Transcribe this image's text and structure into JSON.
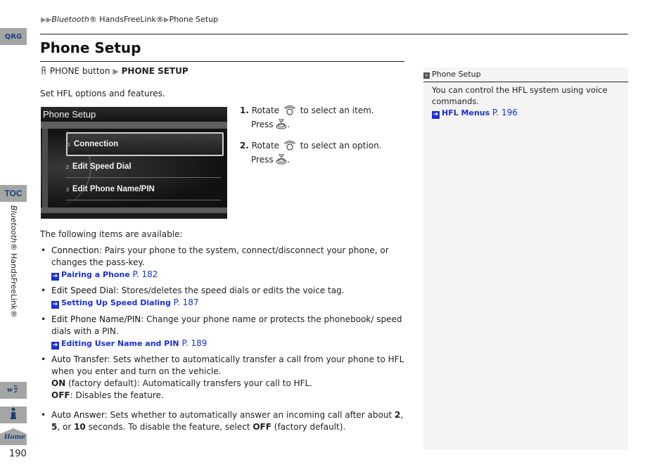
{
  "side_tabs": {
    "qrg": "QRG",
    "toc": "TOC",
    "section_label_italic": "Bluetooth",
    "section_label_rest": "® HandsFreeLink®",
    "voice_icon": "voice-command-icon",
    "index_icon": "info-index-icon",
    "home": "Home"
  },
  "breadcrumb": {
    "part1_italic": "Bluetooth",
    "part1_rest": "® HandsFreeLink®",
    "part2": "Phone Setup"
  },
  "page": {
    "title": "Phone Setup",
    "menu_path_button": "PHONE button",
    "menu_path_target": "PHONE SETUP",
    "intro": "Set HFL options and features.",
    "page_number": "190"
  },
  "screen": {
    "title": "Phone Setup",
    "items": [
      {
        "num": "1",
        "label": "Connection"
      },
      {
        "num": "2",
        "label": "Edit Speed Dial"
      },
      {
        "num": "3",
        "label": "Edit Phone Name/PIN"
      }
    ]
  },
  "steps": [
    {
      "num": "1.",
      "text_a": "Rotate",
      "text_b": "to select an item.",
      "text_c": "Press"
    },
    {
      "num": "2.",
      "text_a": "Rotate",
      "text_b": "to select an option.",
      "text_c": "Press"
    }
  ],
  "available_intro": "The following items are available:",
  "items": [
    {
      "term": "Connection",
      "desc": ": Pairs your phone to the system, connect/disconnect your phone, or changes the pass-key.",
      "xref": "Pairing a Phone",
      "xref_page": "P. 182"
    },
    {
      "term": "Edit Speed Dial",
      "desc": ": Stores/deletes the speed dials or edits the voice tag.",
      "xref": "Setting Up Speed Dialing",
      "xref_page": "P. 187"
    },
    {
      "term": "Edit Phone Name/PIN",
      "desc": ": Change your phone name or protects the phonebook/ speed dials with a PIN.",
      "xref": "Editing User Name and PIN",
      "xref_page": "P. 189"
    },
    {
      "term": "Auto Transfer",
      "desc": ": Sets whether to automatically transfer a call from your phone to HFL when you enter and turn on the vehicle.",
      "on_label": "ON",
      "on_text": " (factory default): Automatically transfers your call to HFL.",
      "off_label": "OFF",
      "off_text": ": Disables the feature."
    },
    {
      "term": "Auto Answer",
      "desc": ": Sets whether to automatically answer an incoming call after about ",
      "v1": "2",
      "sep1": ", ",
      "v2": "5",
      "sep2": ", or ",
      "v3": "10",
      "desc2": " seconds. To disable the feature, select ",
      "off_label": "OFF",
      "desc3": " (factory default)."
    }
  ],
  "note": {
    "heading": "Phone Setup",
    "text": "You can control the HFL system using voice commands.",
    "xref": "HFL Menus",
    "xref_page": "P. 196"
  },
  "colors": {
    "link_blue": "#1a2fd6",
    "tab_gray": "#a3a6a3",
    "tab_text_blue": "#1d3f7a",
    "note_bg": "#f4f4f4"
  }
}
